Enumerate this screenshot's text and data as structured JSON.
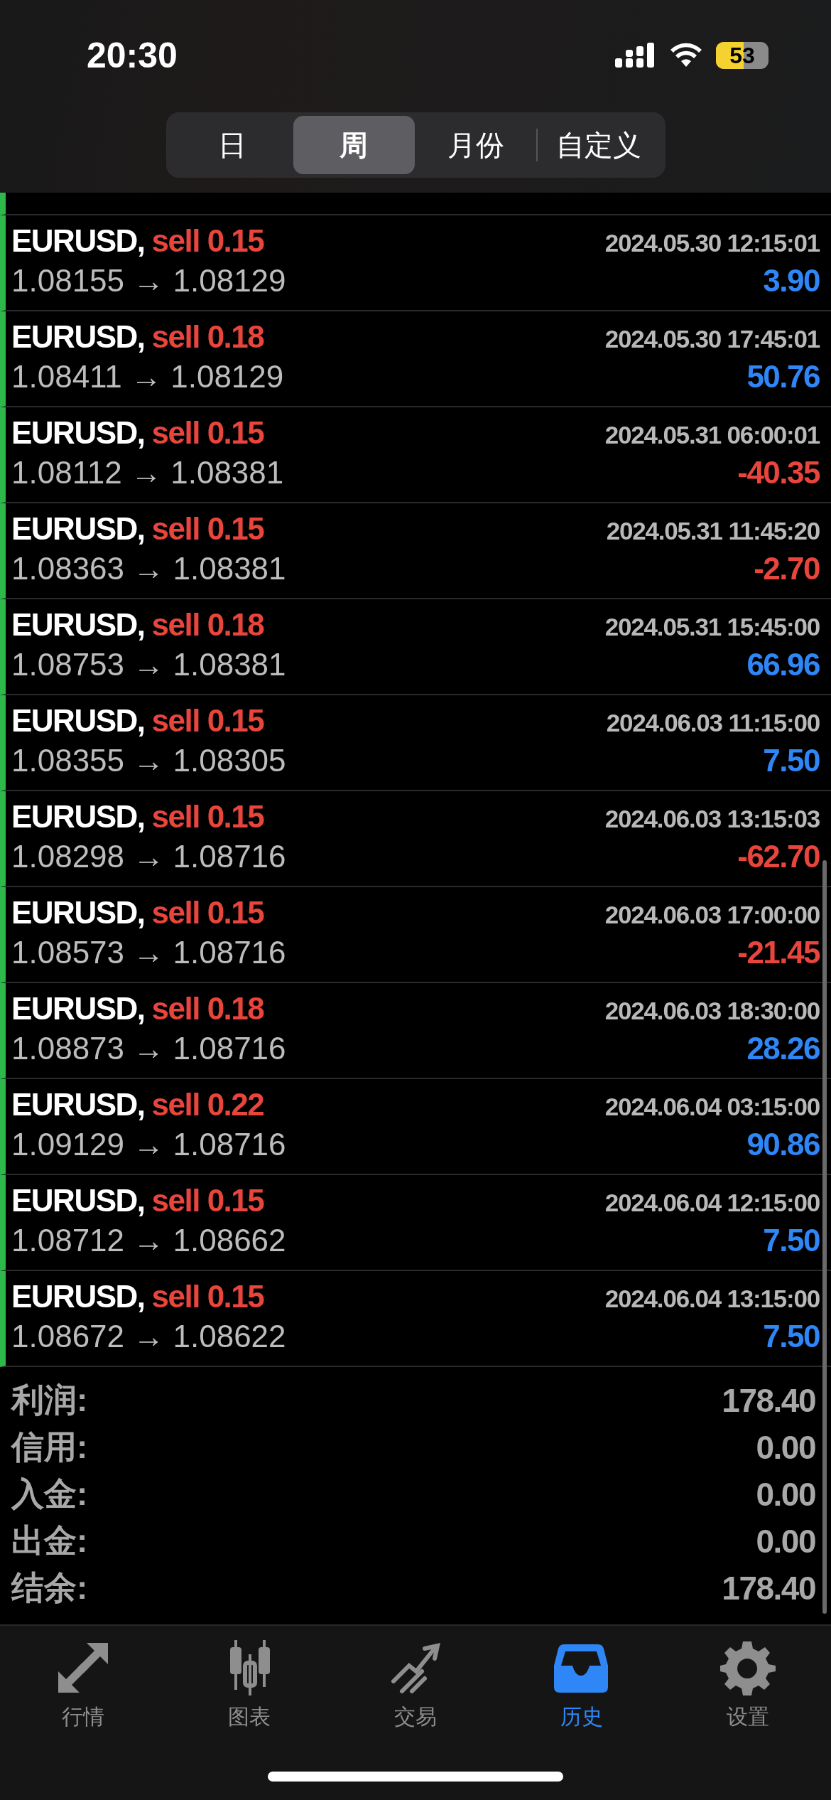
{
  "status_bar": {
    "time": "20:30",
    "battery": "53"
  },
  "period_tabs": [
    {
      "label": "日",
      "selected": false
    },
    {
      "label": "周",
      "selected": true
    },
    {
      "label": "月份",
      "selected": false
    },
    {
      "label": "自定义",
      "selected": false
    }
  ],
  "trades": [
    {
      "symbol": "EURUSD,",
      "order": "sell 0.15",
      "time": "2024.05.30 12:15:01",
      "prices": "1.08155 → 1.08129",
      "profit": "3.90",
      "color": "#2f86f6"
    },
    {
      "symbol": "EURUSD,",
      "order": "sell 0.18",
      "time": "2024.05.30 17:45:01",
      "prices": "1.08411 → 1.08129",
      "profit": "50.76",
      "color": "#2f86f6"
    },
    {
      "symbol": "EURUSD,",
      "order": "sell 0.15",
      "time": "2024.05.31 06:00:01",
      "prices": "1.08112 → 1.08381",
      "profit": "-40.35",
      "color": "#e8453c"
    },
    {
      "symbol": "EURUSD,",
      "order": "sell 0.15",
      "time": "2024.05.31 11:45:20",
      "prices": "1.08363 → 1.08381",
      "profit": "-2.70",
      "color": "#e8453c"
    },
    {
      "symbol": "EURUSD,",
      "order": "sell 0.18",
      "time": "2024.05.31 15:45:00",
      "prices": "1.08753 → 1.08381",
      "profit": "66.96",
      "color": "#2f86f6"
    },
    {
      "symbol": "EURUSD,",
      "order": "sell 0.15",
      "time": "2024.06.03 11:15:00",
      "prices": "1.08355 → 1.08305",
      "profit": "7.50",
      "color": "#2f86f6"
    },
    {
      "symbol": "EURUSD,",
      "order": "sell 0.15",
      "time": "2024.06.03 13:15:03",
      "prices": "1.08298 → 1.08716",
      "profit": "-62.70",
      "color": "#e8453c"
    },
    {
      "symbol": "EURUSD,",
      "order": "sell 0.15",
      "time": "2024.06.03 17:00:00",
      "prices": "1.08573 → 1.08716",
      "profit": "-21.45",
      "color": "#e8453c"
    },
    {
      "symbol": "EURUSD,",
      "order": "sell 0.18",
      "time": "2024.06.03 18:30:00",
      "prices": "1.08873 → 1.08716",
      "profit": "28.26",
      "color": "#2f86f6"
    },
    {
      "symbol": "EURUSD,",
      "order": "sell 0.22",
      "time": "2024.06.04 03:15:00",
      "prices": "1.09129 → 1.08716",
      "profit": "90.86",
      "color": "#2f86f6"
    },
    {
      "symbol": "EURUSD,",
      "order": "sell 0.15",
      "time": "2024.06.04 12:15:00",
      "prices": "1.08712 → 1.08662",
      "profit": "7.50",
      "color": "#2f86f6"
    },
    {
      "symbol": "EURUSD,",
      "order": "sell 0.15",
      "time": "2024.06.04 13:15:00",
      "prices": "1.08672 → 1.08622",
      "profit": "7.50",
      "color": "#2f86f6"
    }
  ],
  "summary": [
    {
      "label": "利润:",
      "value": "178.40"
    },
    {
      "label": "信用:",
      "value": "0.00"
    },
    {
      "label": "入金:",
      "value": "0.00"
    },
    {
      "label": "出金:",
      "value": "0.00"
    },
    {
      "label": "结余:",
      "value": "178.40"
    }
  ],
  "tab_bar": [
    {
      "label": "行情",
      "kind": "quotes",
      "selected": false
    },
    {
      "label": "图表",
      "kind": "chart",
      "selected": false
    },
    {
      "label": "交易",
      "kind": "trade",
      "selected": false
    },
    {
      "label": "历史",
      "kind": "history",
      "selected": true
    },
    {
      "label": "设置",
      "kind": "settings",
      "selected": false
    }
  ]
}
